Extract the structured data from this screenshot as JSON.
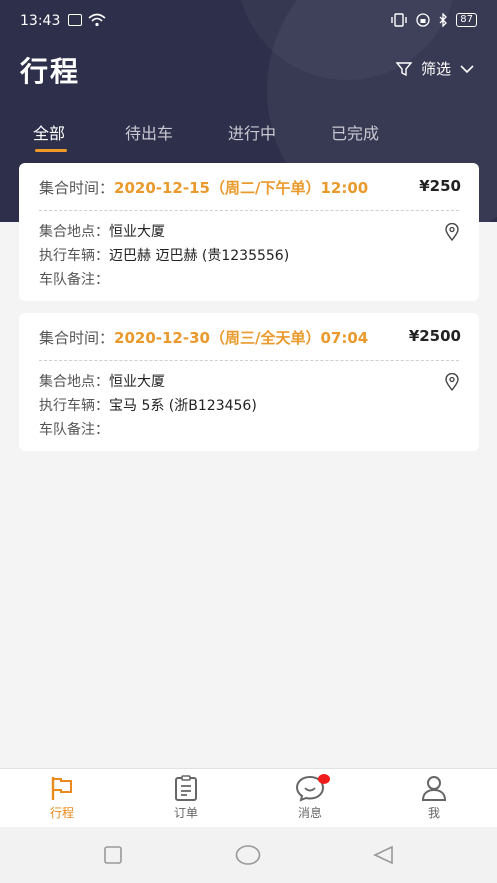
{
  "status_bar": {
    "time": "13:43",
    "battery": "87"
  },
  "header": {
    "title": "行程",
    "filter_label": "筛选"
  },
  "tabs": [
    {
      "label": "全部",
      "active": true
    },
    {
      "label": "待出车",
      "active": false
    },
    {
      "label": "进行中",
      "active": false
    },
    {
      "label": "已完成",
      "active": false
    }
  ],
  "trips": [
    {
      "time_label": "集合时间：",
      "time_value": "2020-12-15（周二/下午单）12:00",
      "price": "¥250",
      "location_label": "集合地点：",
      "location_value": "恒业大厦",
      "vehicle_label": "执行车辆：",
      "vehicle_value": "迈巴赫 迈巴赫 (贵1235556)",
      "note_label": "车队备注：",
      "note_value": ""
    },
    {
      "time_label": "集合时间：",
      "time_value": "2020-12-30（周三/全天单）07:04",
      "price": "¥2500",
      "location_label": "集合地点：",
      "location_value": "恒业大厦",
      "vehicle_label": "执行车辆：",
      "vehicle_value": "宝马 5系 (浙B123456)",
      "note_label": "车队备注：",
      "note_value": ""
    }
  ],
  "bottom_nav": [
    {
      "label": "行程",
      "icon": "flag-icon",
      "active": true
    },
    {
      "label": "订单",
      "icon": "clipboard-icon",
      "active": false
    },
    {
      "label": "消息",
      "icon": "chat-bubble-icon",
      "active": false,
      "badge": true
    },
    {
      "label": "我",
      "icon": "person-icon",
      "active": false
    }
  ],
  "colors": {
    "header_bg": "#2e2f4a",
    "accent": "#ea9a2c",
    "badge": "#f01c1c"
  }
}
